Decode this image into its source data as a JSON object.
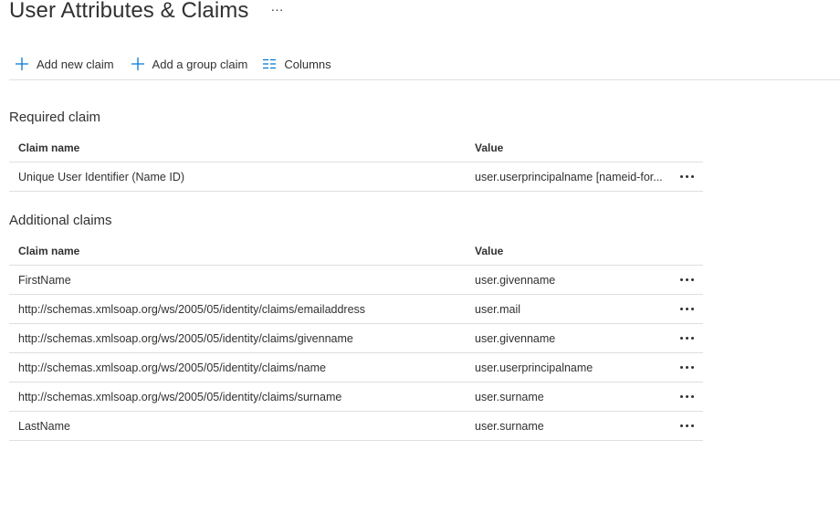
{
  "header": {
    "title": "User Attributes & Claims",
    "more_label": "···"
  },
  "toolbar": {
    "add_claim_label": "Add new claim",
    "add_group_claim_label": "Add a group claim",
    "columns_label": "Columns",
    "accent_color": "#0078d4"
  },
  "required": {
    "title": "Required claim",
    "col_name": "Claim name",
    "col_value": "Value",
    "rows": [
      {
        "name": "Unique User Identifier (Name ID)",
        "value": "user.userprincipalname [nameid-for..."
      }
    ]
  },
  "additional": {
    "title": "Additional claims",
    "col_name": "Claim name",
    "col_value": "Value",
    "rows": [
      {
        "name": "FirstName",
        "value": "user.givenname"
      },
      {
        "name": "http://schemas.xmlsoap.org/ws/2005/05/identity/claims/emailaddress",
        "value": "user.mail"
      },
      {
        "name": "http://schemas.xmlsoap.org/ws/2005/05/identity/claims/givenname",
        "value": "user.givenname"
      },
      {
        "name": "http://schemas.xmlsoap.org/ws/2005/05/identity/claims/name",
        "value": "user.userprincipalname"
      },
      {
        "name": "http://schemas.xmlsoap.org/ws/2005/05/identity/claims/surname",
        "value": "user.surname"
      },
      {
        "name": "LastName",
        "value": "user.surname"
      }
    ]
  }
}
